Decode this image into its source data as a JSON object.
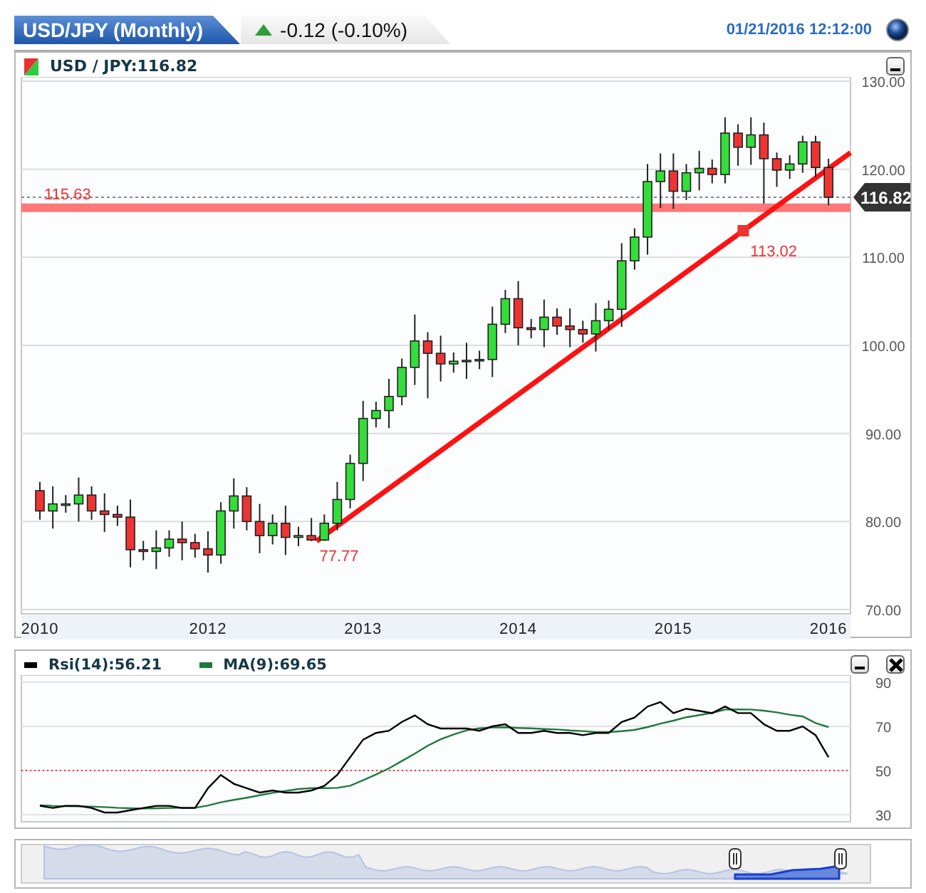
{
  "header": {
    "title": "USD/JPY (Monthly)",
    "change": "-0.12 (-0.10%)",
    "rising": true,
    "timestamp": "01/21/2016 12:12:00"
  },
  "price_panel": {
    "symbol_label": "USD / JPY:116.82",
    "chart_data": {
      "type": "candlestick",
      "ylim": [
        70,
        130
      ],
      "yticks": [
        {
          "value": 130,
          "label": "130.00"
        },
        {
          "value": 120,
          "label": "120.00"
        },
        {
          "value": 110,
          "label": "110.00"
        },
        {
          "value": 100,
          "label": "100.00"
        },
        {
          "value": 90,
          "label": "90.00"
        },
        {
          "value": 80,
          "label": "80.00"
        },
        {
          "value": 70,
          "label": "70.00"
        }
      ],
      "categories": [
        "2010",
        null,
        null,
        null,
        null,
        null,
        null,
        null,
        null,
        null,
        null,
        null,
        null,
        "2012",
        null,
        null,
        null,
        null,
        null,
        null,
        null,
        null,
        null,
        null,
        null,
        "2013",
        null,
        null,
        null,
        null,
        null,
        null,
        null,
        null,
        null,
        null,
        null,
        "2014",
        null,
        null,
        null,
        null,
        null,
        null,
        null,
        null,
        null,
        null,
        null,
        "2015",
        null,
        null,
        null,
        null,
        null,
        null,
        null,
        null,
        null,
        null,
        null,
        "2016"
      ],
      "ohlc": [
        [
          83.5,
          84.5,
          80.2,
          81.2
        ],
        [
          81.2,
          84.0,
          79.2,
          82.0
        ],
        [
          82.0,
          83.0,
          81.0,
          82.0
        ],
        [
          82.0,
          85.0,
          80.0,
          83.0
        ],
        [
          83.0,
          84.0,
          80.2,
          81.2
        ],
        [
          81.2,
          83.2,
          78.8,
          80.8
        ],
        [
          80.8,
          81.8,
          79.5,
          80.5
        ],
        [
          80.5,
          82.5,
          74.8,
          76.8
        ],
        [
          76.8,
          77.8,
          75.6,
          76.6
        ],
        [
          76.6,
          79.0,
          74.6,
          77.0
        ],
        [
          77.0,
          79.0,
          76.0,
          78.0
        ],
        [
          78.0,
          80.0,
          75.6,
          77.6
        ],
        [
          77.6,
          78.6,
          75.9,
          76.9
        ],
        [
          76.9,
          78.9,
          74.2,
          76.2
        ],
        [
          76.2,
          82.2,
          75.2,
          81.2
        ],
        [
          81.2,
          84.9,
          79.2,
          82.9
        ],
        [
          82.9,
          83.9,
          79.0,
          80.0
        ],
        [
          80.0,
          82.0,
          76.4,
          78.4
        ],
        [
          78.4,
          80.8,
          77.4,
          79.8
        ],
        [
          79.8,
          81.8,
          76.2,
          78.2
        ],
        [
          78.2,
          79.4,
          77.2,
          78.4
        ],
        [
          78.4,
          80.4,
          77.77,
          77.9
        ],
        [
          77.9,
          80.8,
          77.8,
          79.8
        ],
        [
          79.8,
          84.5,
          79.0,
          82.5
        ],
        [
          82.5,
          87.6,
          81.5,
          86.6
        ],
        [
          86.6,
          93.7,
          84.6,
          91.7
        ],
        [
          91.7,
          93.6,
          90.7,
          92.6
        ],
        [
          92.6,
          96.2,
          90.6,
          94.2
        ],
        [
          94.2,
          98.5,
          93.2,
          97.5
        ],
        [
          97.5,
          103.5,
          95.5,
          100.5
        ],
        [
          100.5,
          101.5,
          94.0,
          99.1
        ],
        [
          99.1,
          101.1,
          95.9,
          97.9
        ],
        [
          97.9,
          99.2,
          96.9,
          98.2
        ],
        [
          98.2,
          100.3,
          96.2,
          98.3
        ],
        [
          98.3,
          99.4,
          97.3,
          98.4
        ],
        [
          98.4,
          104.4,
          96.4,
          102.4
        ],
        [
          102.4,
          106.3,
          101.4,
          105.3
        ],
        [
          105.3,
          107.3,
          100.0,
          102.0
        ],
        [
          102.0,
          103.0,
          100.8,
          101.8
        ],
        [
          101.8,
          105.2,
          99.8,
          103.2
        ],
        [
          103.2,
          104.2,
          101.2,
          102.2
        ],
        [
          102.2,
          104.2,
          99.8,
          101.8
        ],
        [
          101.8,
          102.8,
          100.3,
          101.3
        ],
        [
          101.3,
          104.8,
          99.3,
          102.8
        ],
        [
          102.8,
          105.1,
          101.8,
          104.1
        ],
        [
          104.1,
          111.6,
          102.1,
          109.6
        ],
        [
          109.6,
          113.3,
          108.6,
          112.3
        ],
        [
          112.3,
          120.6,
          110.3,
          118.6
        ],
        [
          118.6,
          121.8,
          115.6,
          119.8
        ],
        [
          119.8,
          121.8,
          115.5,
          117.5
        ],
        [
          117.5,
          120.6,
          116.5,
          119.6
        ],
        [
          119.6,
          122.1,
          117.6,
          120.1
        ],
        [
          120.1,
          121.1,
          118.4,
          119.4
        ],
        [
          119.4,
          125.9,
          118.4,
          124.1
        ],
        [
          124.1,
          125.1,
          120.4,
          122.5
        ],
        [
          122.5,
          125.9,
          120.5,
          123.9
        ],
        [
          123.9,
          125.3,
          116.1,
          121.2
        ],
        [
          121.2,
          121.9,
          118.0,
          119.9
        ],
        [
          119.9,
          121.6,
          118.9,
          120.6
        ],
        [
          120.6,
          123.8,
          119.6,
          123.1
        ],
        [
          123.1,
          123.8,
          119.1,
          120.2
        ],
        [
          120.2,
          121.2,
          115.9,
          116.82
        ]
      ],
      "grid": true,
      "ref_lines": [
        {
          "axis": "y",
          "value": 115.63,
          "label": "115.63",
          "color": "#ff7777"
        },
        {
          "axis": "y",
          "value": 116.82,
          "label": "116.82",
          "color": "#888888"
        }
      ]
    },
    "overlay_labels": {
      "trend_start": "77.77",
      "trend_point": "113.02"
    }
  },
  "rsi_panel": {
    "legend": [
      {
        "label": "Rsi(14):56.21",
        "color": "#000000"
      },
      {
        "label": "MA(9):69.65",
        "color": "#1f7a3c"
      }
    ],
    "chart_data": {
      "type": "line",
      "ylim": [
        30,
        90
      ],
      "yticks": [
        90,
        70,
        50,
        30
      ],
      "grid": true,
      "ref_lines": [
        {
          "axis": "y",
          "value": 50,
          "color": "#ee3333"
        }
      ],
      "series": [
        {
          "color": "#000000",
          "values": [
            34,
            33,
            34,
            34,
            33,
            31,
            31,
            32,
            33,
            34,
            34,
            33,
            33,
            42,
            48,
            44,
            42,
            40,
            41,
            40,
            40,
            41,
            43,
            48,
            56,
            64,
            67,
            68,
            72,
            75,
            71,
            69,
            69,
            69,
            68,
            70,
            71,
            67,
            67,
            68,
            67,
            67,
            66,
            67,
            67,
            72,
            74,
            79,
            81,
            76,
            78,
            77,
            76,
            79,
            76,
            76,
            71,
            68,
            68,
            70,
            66,
            56
          ]
        },
        {
          "color": "#1f7a3c",
          "values": [
            34.3,
            34,
            33.9,
            33.8,
            33.7,
            33.4,
            33.1,
            32.9,
            32.8,
            32.9,
            33,
            33.1,
            33.1,
            34.1,
            35.6,
            36.7,
            37.7,
            38.8,
            39.9,
            40.8,
            41.6,
            42,
            42,
            42.1,
            43.1,
            45.6,
            48.2,
            51,
            54.3,
            57.7,
            61.2,
            64.1,
            66.3,
            68.2,
            69.1,
            69.5,
            69.6,
            69.3,
            69.1,
            68.8,
            68.6,
            68.1,
            67.9,
            67.4,
            67.4,
            67.8,
            68.4,
            69.7,
            71.2,
            72.6,
            74.1,
            75.1,
            76.1,
            77.6,
            77.7,
            77.6,
            77.1,
            76.3,
            75.3,
            74.5,
            71.5,
            69.7
          ]
        }
      ]
    }
  }
}
